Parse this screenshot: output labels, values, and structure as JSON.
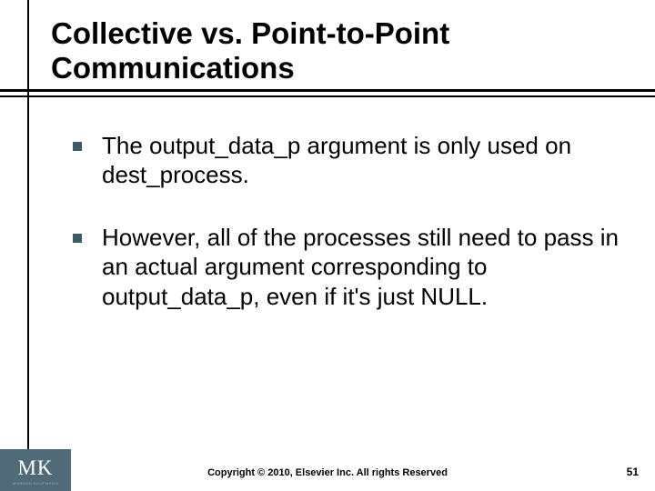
{
  "title": "Collective vs. Point-to-Point Communications",
  "bullets": [
    "The output_data_p argument is only used on dest_process.",
    "However, all of the processes still need to pass in an actual argument corresponding to output_data_p, even if it's just NULL."
  ],
  "footer": "Copyright © 2010, Elsevier Inc. All rights Reserved",
  "page_number": "51",
  "logo": {
    "main": "MK",
    "sub": "MORGAN KAUFMANN"
  }
}
